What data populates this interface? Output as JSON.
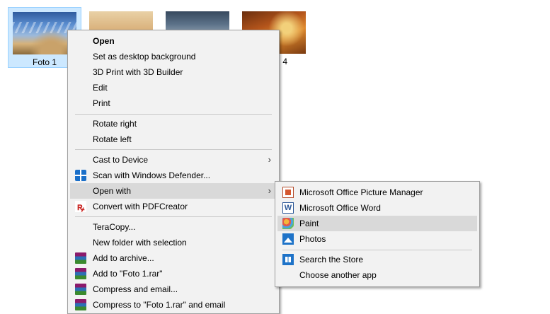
{
  "files": [
    {
      "label": "Foto 1"
    },
    {
      "label": ""
    },
    {
      "label": ""
    },
    {
      "label": "4"
    }
  ],
  "context_menu": {
    "open": "Open",
    "set_desktop_background": "Set as desktop background",
    "print_3d": "3D Print with 3D Builder",
    "edit": "Edit",
    "print": "Print",
    "rotate_right": "Rotate right",
    "rotate_left": "Rotate left",
    "cast_to_device": "Cast to Device",
    "scan_defender": "Scan with Windows Defender...",
    "open_with": "Open with",
    "convert_pdfcreator": "Convert with PDFCreator",
    "teracopy": "TeraCopy...",
    "new_folder_selection": "New folder with selection",
    "add_to_archive": "Add to archive...",
    "add_to_rar": "Add to \"Foto 1.rar\"",
    "compress_email": "Compress and email...",
    "compress_rar_email": "Compress to \"Foto 1.rar\" and email",
    "submenu_arrow": "›"
  },
  "open_with_menu": {
    "picture_manager": "Microsoft Office Picture Manager",
    "word": "Microsoft Office Word",
    "paint": "Paint",
    "photos": "Photos",
    "search_store": "Search the Store",
    "choose_another": "Choose another app"
  },
  "icons": {
    "defender": "windows-defender-shield",
    "pdfcreator": "pdfcreator-logo",
    "winrar": "winrar-books",
    "picture_manager": "picture-manager",
    "word": "word",
    "paint": "paint-palette",
    "photos": "photos",
    "store": "store"
  },
  "colors": {
    "selection_bg": "#cce8ff",
    "selection_border": "#99d1ff",
    "menu_bg": "#f2f2f2",
    "menu_highlight": "#d9d9d9"
  }
}
